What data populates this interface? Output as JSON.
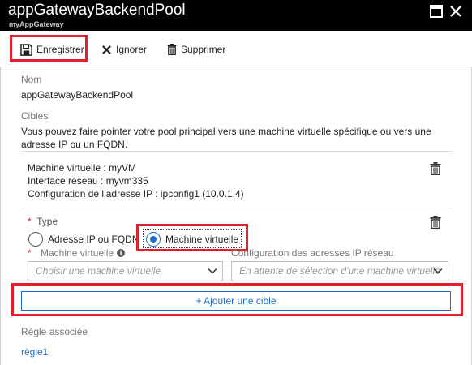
{
  "window": {
    "title": "appGatewayBackendPool",
    "subtitle": "myAppGateway"
  },
  "toolbar": {
    "save_label": "Enregistrer",
    "discard_label": "Ignorer",
    "delete_label": "Supprimer"
  },
  "form": {
    "name_label": "Nom",
    "name_value": "appGatewayBackendPool",
    "targets_label": "Cibles",
    "targets_description": "Vous pouvez faire pointer votre pool principal vers une machine virtuelle spécifique ou vers une adresse IP ou un FQDN.",
    "existing_target": {
      "vm_line": "Machine virtuelle : myVM",
      "nic_line": "Interface réseau : myvm335",
      "ipconfig_line": "Configuration de l’adresse IP : ipconfig1 (10.0.1.4)"
    },
    "new_target": {
      "required_mark": "*",
      "type_label": "Type",
      "radio_ip_label": "Adresse IP ou FQDN",
      "radio_vm_label": "Machine virtuelle",
      "selected_type": "Machine virtuelle",
      "vm_label": "Machine virtuelle",
      "vm_placeholder": "Choisir une machine virtuelle",
      "ipconfig_label": "Configuration des adresses IP réseau",
      "ipconfig_placeholder": "En attente de sélection d'une machine virtuelle"
    },
    "add_target_label": "+ Ajouter une cible",
    "rule_label": "Règle associée",
    "rule_link": "règle1"
  },
  "colors": {
    "highlight": "#e0202a",
    "accent": "#1f6fd1",
    "titlebar": "#000000"
  }
}
